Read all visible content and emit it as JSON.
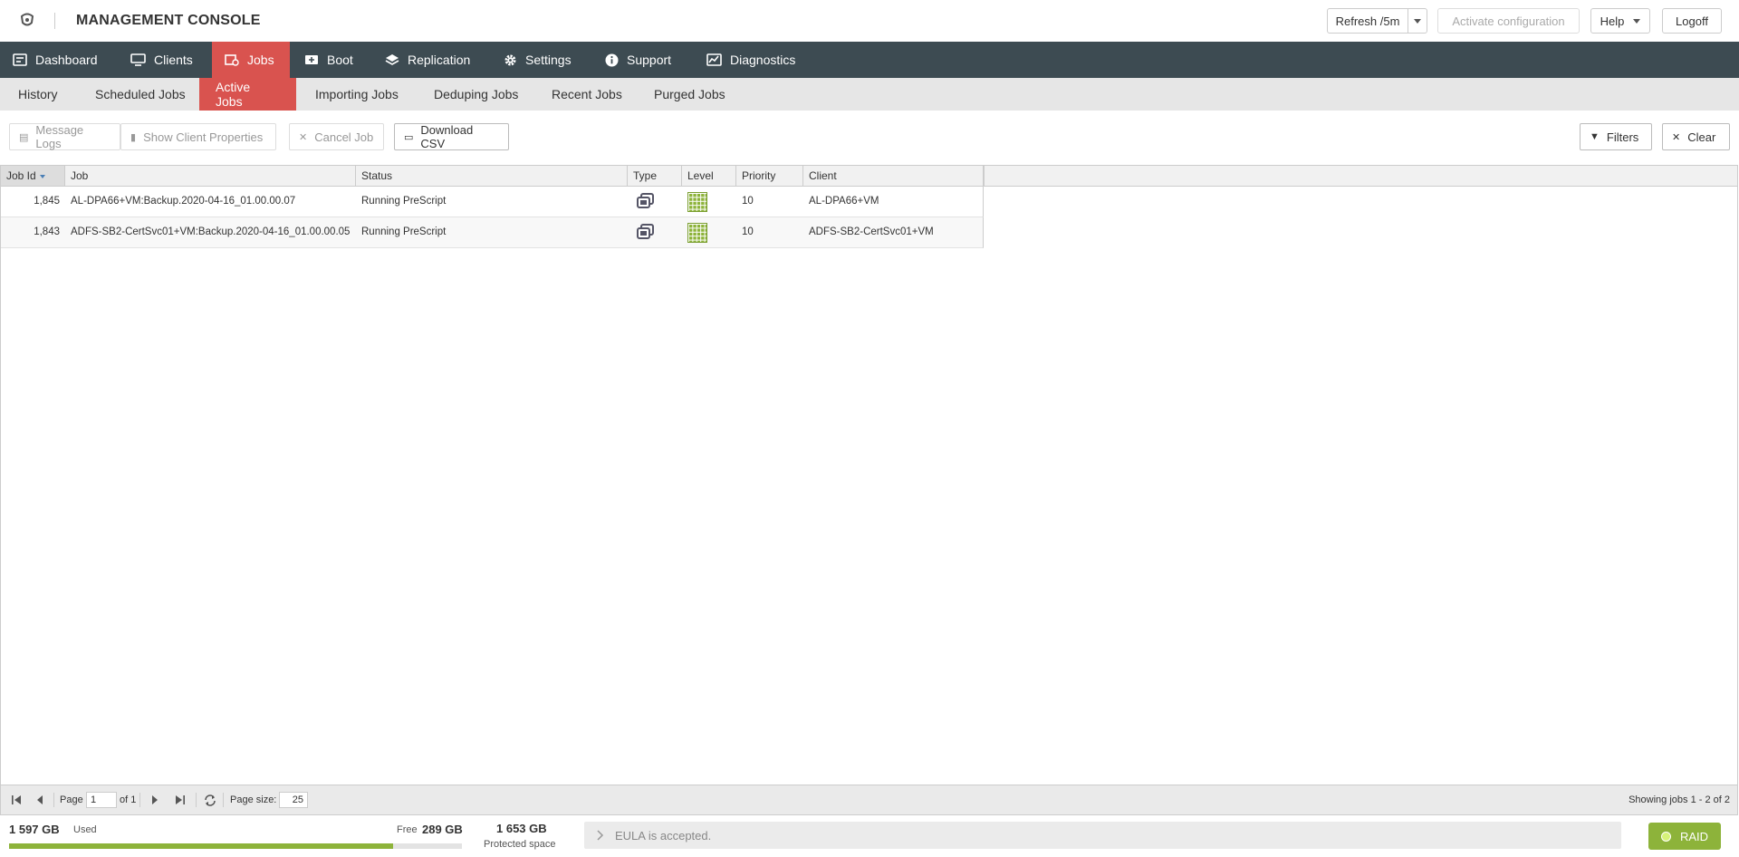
{
  "header": {
    "app_title": "MANAGEMENT CONSOLE",
    "refresh_label": "Refresh /5m",
    "activate_label": "Activate configuration",
    "help_label": "Help",
    "logoff_label": "Logoff"
  },
  "nav": {
    "items": [
      {
        "label": "Dashboard",
        "icon": "dashboard-icon"
      },
      {
        "label": "Clients",
        "icon": "monitor-icon"
      },
      {
        "label": "Jobs",
        "icon": "jobs-icon",
        "active": true
      },
      {
        "label": "Boot",
        "icon": "boot-icon"
      },
      {
        "label": "Replication",
        "icon": "layers-icon"
      },
      {
        "label": "Settings",
        "icon": "gear-icon"
      },
      {
        "label": "Support",
        "icon": "info-icon"
      },
      {
        "label": "Diagnostics",
        "icon": "chart-icon"
      }
    ]
  },
  "subnav": {
    "items": [
      {
        "label": "History"
      },
      {
        "label": "Scheduled Jobs"
      },
      {
        "label": "Active Jobs",
        "active": true
      },
      {
        "label": "Importing Jobs"
      },
      {
        "label": "Deduping Jobs"
      },
      {
        "label": "Recent Jobs"
      },
      {
        "label": "Purged Jobs"
      }
    ]
  },
  "toolbar": {
    "message_logs": "Message Logs",
    "show_client_properties": "Show Client Properties",
    "cancel_job": "Cancel Job",
    "download_csv": "Download CSV",
    "filters": "Filters",
    "clear": "Clear"
  },
  "grid": {
    "columns": [
      "Job Id",
      "Job",
      "Status",
      "Type",
      "Level",
      "Priority",
      "Client"
    ],
    "rows": [
      {
        "job_id": "1,845",
        "job": "AL-DPA66+VM:Backup.2020-04-16_01.00.00.07",
        "status": "Running PreScript",
        "type": "backup-copy-icon",
        "level": "full-level-icon",
        "priority": "10",
        "client": "AL-DPA66+VM"
      },
      {
        "job_id": "1,843",
        "job": "ADFS-SB2-CertSvc01+VM:Backup.2020-04-16_01.00.00.05",
        "status": "Running PreScript",
        "type": "backup-copy-icon",
        "level": "full-level-icon",
        "priority": "10",
        "client": "ADFS-SB2-CertSvc01+VM"
      }
    ]
  },
  "pager": {
    "page_label": "Page",
    "page_value": "1",
    "of_label": "of 1",
    "page_size_label": "Page size:",
    "page_size_value": "25",
    "showing": "Showing jobs 1 - 2 of 2"
  },
  "footer": {
    "used_value": "1 597 GB",
    "used_label": "Used",
    "used_fraction": 0.847,
    "free_label": "Free",
    "free_value": "289 GB",
    "protected_value": "1 653 GB",
    "protected_label": "Protected space",
    "eula_text": "EULA is accepted.",
    "raid_label": "RAID"
  },
  "colors": {
    "nav_bg": "#3d4b52",
    "accent_red": "#d9534f",
    "status_green": "#8db33a"
  }
}
